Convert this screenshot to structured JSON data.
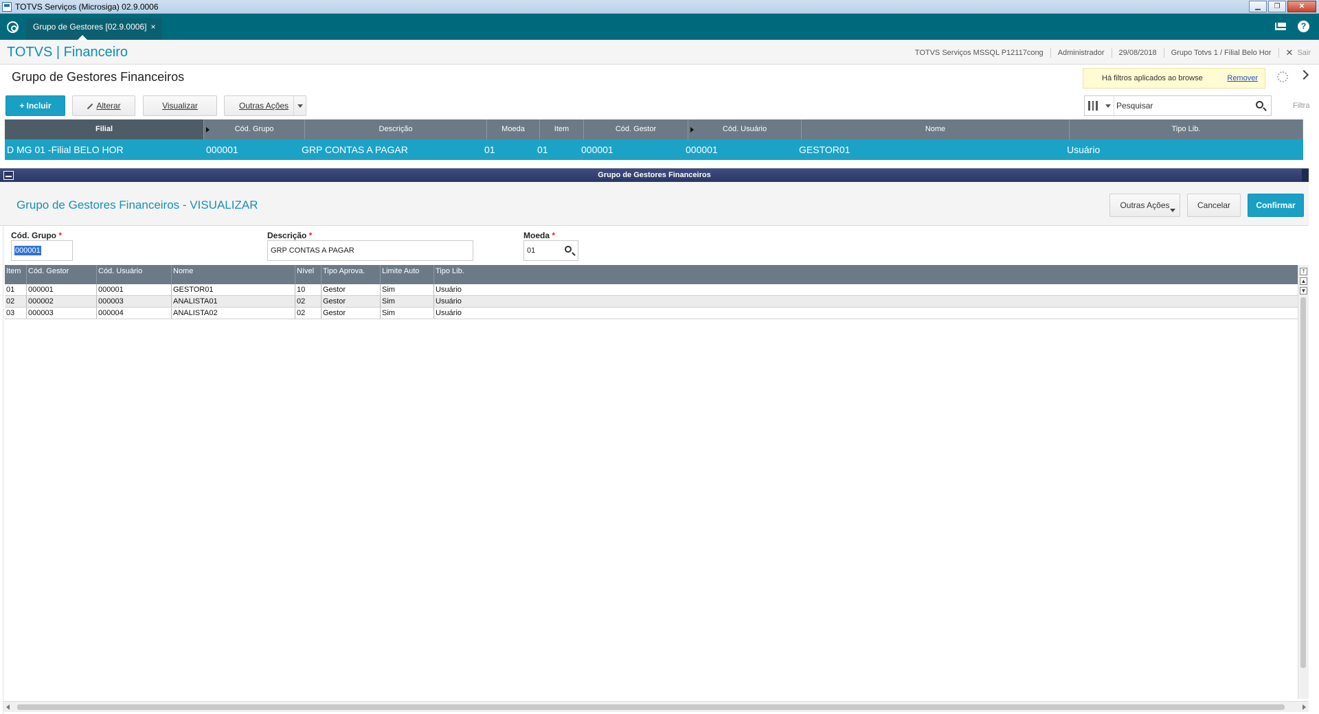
{
  "window": {
    "title": "TOTVS Serviços (Microsiga) 02.9.0006",
    "minimize": "▁",
    "restore": "❐",
    "close": "✕"
  },
  "tabbar": {
    "tab_label": "Grupo de Gestores [02.9.0006]",
    "tab_close": "×",
    "help": "?"
  },
  "header": {
    "brand": "TOTVS | Financeiro",
    "server": "TOTVS Serviços MSSQL P12117cong",
    "user": "Administrador",
    "date": "29/08/2018",
    "branch": "Grupo Totvs 1 / Filial Belo Hor",
    "logout": "Sair"
  },
  "page": {
    "title": "Grupo de Gestores Financeiros"
  },
  "filter_notice": {
    "message": "Há filtros aplicados ao browse",
    "remove": "Remover"
  },
  "toolbar": {
    "include": "Incluir",
    "edit": "Alterar",
    "view": "Visualizar",
    "other": "Outras Ações"
  },
  "search": {
    "placeholder": "Pesquisar",
    "value": "Pesquisar",
    "filter_label": "Filtra"
  },
  "browse": {
    "columns": [
      "Filial",
      "Cód. Grupo",
      "Descrição",
      "Moeda",
      "Item",
      "Cód. Gestor",
      "Cód. Usuário",
      "Nome",
      "Tipo Lib."
    ],
    "row": [
      "D MG 01 -Filial BELO HOR",
      "000001",
      "GRP CONTAS A PAGAR",
      "01",
      "01",
      "000001",
      "000001",
      "GESTOR01",
      "Usuário"
    ]
  },
  "dialog": {
    "bar_title": "Grupo de Gestores Financeiros",
    "title": "Grupo de Gestores Financeiros - VISUALIZAR",
    "other_actions": "Outras Ações",
    "cancel": "Cancelar",
    "confirm": "Confirmar",
    "fields": {
      "group_label": "Cód. Grupo",
      "group_value": "000001",
      "desc_label": "Descrição",
      "desc_value": "GRP CONTAS A PAGAR",
      "currency_label": "Moeda",
      "currency_value": "01",
      "required_mark": "*"
    }
  },
  "items": {
    "columns": [
      "Item",
      "Cód. Gestor",
      "Cód. Usuário",
      "Nome",
      "Nível",
      "Tipo Aprova.",
      "Limite Auto",
      "Tipo Lib."
    ],
    "rows": [
      [
        "01",
        "000001",
        "000001",
        "GESTOR01",
        "10",
        "Gestor",
        "Sim",
        "Usuário"
      ],
      [
        "02",
        "000002",
        "000003",
        "ANALISTA01",
        "02",
        "Gestor",
        "Sim",
        "Usuário"
      ],
      [
        "03",
        "000003",
        "000004",
        "ANALISTA02",
        "02",
        "Gestor",
        "Sim",
        "Usuário"
      ]
    ]
  },
  "colors": {
    "teal": "#006a7d",
    "accent": "#1aa0c5",
    "grid_header": "#6c7a87",
    "dialog_bar": "#2b3763"
  }
}
